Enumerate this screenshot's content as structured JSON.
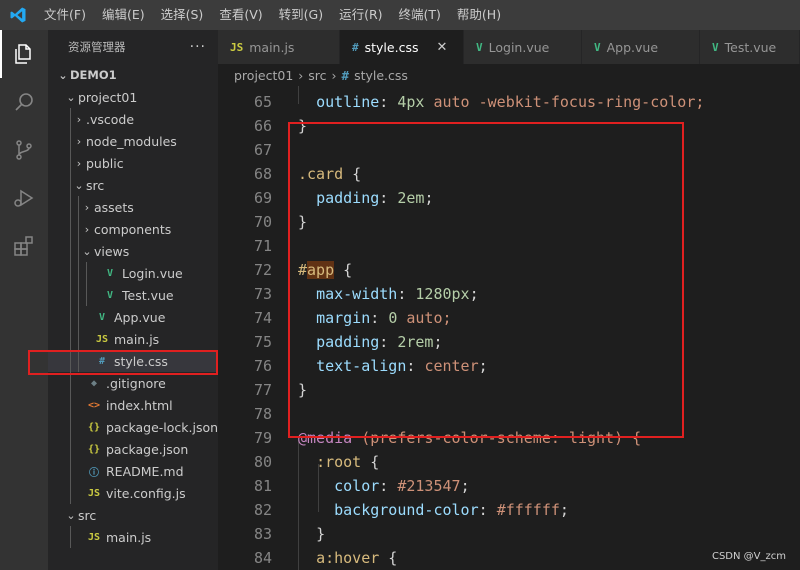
{
  "menu": {
    "items": [
      "文件(F)",
      "编辑(E)",
      "选择(S)",
      "查看(V)",
      "转到(G)",
      "运行(R)",
      "终端(T)",
      "帮助(H)"
    ]
  },
  "colors": {
    "accent_blue": "#007acc",
    "vue_green": "#41b883",
    "js_yellow": "#cbcb41",
    "css_blue": "#519aba",
    "annotation_red": "#e02020"
  },
  "sidebar": {
    "title": "资源管理器",
    "more": "···",
    "tree": [
      {
        "label": "DEMO1",
        "chevron": "⌄",
        "icon": "",
        "level": 0,
        "bold": true
      },
      {
        "label": "project01",
        "chevron": "⌄",
        "icon": "",
        "level": 1
      },
      {
        "label": ".vscode",
        "chevron": "›",
        "icon": "",
        "level": 2
      },
      {
        "label": "node_modules",
        "chevron": "›",
        "icon": "",
        "level": 2
      },
      {
        "label": "public",
        "chevron": "›",
        "icon": "",
        "level": 2
      },
      {
        "label": "src",
        "chevron": "⌄",
        "icon": "",
        "level": 2
      },
      {
        "label": "assets",
        "chevron": "›",
        "icon": "",
        "level": 3
      },
      {
        "label": "components",
        "chevron": "›",
        "icon": "",
        "level": 3
      },
      {
        "label": "views",
        "chevron": "⌄",
        "icon": "",
        "level": 3
      },
      {
        "label": "Login.vue",
        "chevron": "",
        "icon": "V",
        "iconColor": "#41b883",
        "level": 4
      },
      {
        "label": "Test.vue",
        "chevron": "",
        "icon": "V",
        "iconColor": "#41b883",
        "level": 4
      },
      {
        "label": "App.vue",
        "chevron": "",
        "icon": "V",
        "iconColor": "#41b883",
        "level": 3
      },
      {
        "label": "main.js",
        "chevron": "",
        "icon": "JS",
        "iconColor": "#cbcb41",
        "level": 3
      },
      {
        "label": "style.css",
        "chevron": "",
        "icon": "#",
        "iconColor": "#519aba",
        "level": 3,
        "selected": true
      },
      {
        "label": ".gitignore",
        "chevron": "",
        "icon": "◆",
        "iconColor": "#6d8086",
        "level": 2
      },
      {
        "label": "index.html",
        "chevron": "",
        "icon": "<>",
        "iconColor": "#e37933",
        "level": 2
      },
      {
        "label": "package-lock.json",
        "chevron": "",
        "icon": "{}",
        "iconColor": "#cbcb41",
        "level": 2
      },
      {
        "label": "package.json",
        "chevron": "",
        "icon": "{}",
        "iconColor": "#cbcb41",
        "level": 2
      },
      {
        "label": "README.md",
        "chevron": "",
        "icon": "ⓘ",
        "iconColor": "#519aba",
        "level": 2
      },
      {
        "label": "vite.config.js",
        "chevron": "",
        "icon": "JS",
        "iconColor": "#cbcb41",
        "level": 2
      },
      {
        "label": "src",
        "chevron": "⌄",
        "icon": "",
        "level": 1
      },
      {
        "label": "main.js",
        "chevron": "",
        "icon": "JS",
        "iconColor": "#cbcb41",
        "level": 2
      }
    ]
  },
  "tabs": [
    {
      "label": "main.js",
      "icon": "JS",
      "iconColor": "#cbcb41",
      "active": false
    },
    {
      "label": "style.css",
      "icon": "#",
      "iconColor": "#519aba",
      "active": true,
      "close": "✕"
    },
    {
      "label": "Login.vue",
      "icon": "V",
      "iconColor": "#41b883",
      "active": false
    },
    {
      "label": "App.vue",
      "icon": "V",
      "iconColor": "#41b883",
      "active": false
    },
    {
      "label": "Test.vue",
      "icon": "V",
      "iconColor": "#41b883",
      "active": false
    }
  ],
  "breadcrumb": {
    "parts": [
      "project01",
      "src"
    ],
    "file_icon": "#",
    "file": "style.css"
  },
  "editor": {
    "lines": [
      {
        "n": "65",
        "tokens": [
          [
            "  ",
            ""
          ],
          [
            "outline",
            "c-prop"
          ],
          [
            ": ",
            ""
          ],
          [
            "4px",
            "c-num"
          ],
          [
            " auto -webkit-focus-ring-color;",
            "c-val"
          ]
        ]
      },
      {
        "n": "66",
        "tokens": [
          [
            "}",
            "c-brace"
          ]
        ]
      },
      {
        "n": "67",
        "tokens": []
      },
      {
        "n": "68",
        "tokens": [
          [
            ".card",
            "c-sel"
          ],
          [
            " {",
            "c-brace"
          ]
        ]
      },
      {
        "n": "69",
        "tokens": [
          [
            "  ",
            ""
          ],
          [
            "padding",
            "c-prop"
          ],
          [
            ": ",
            ""
          ],
          [
            "2em",
            "c-num"
          ],
          [
            ";",
            ""
          ]
        ]
      },
      {
        "n": "70",
        "tokens": [
          [
            "}",
            "c-brace"
          ]
        ]
      },
      {
        "n": "71",
        "tokens": []
      },
      {
        "n": "72",
        "tokens": [
          [
            "#",
            "c-sel"
          ],
          [
            "app",
            "c-sel hl-word"
          ],
          [
            " {",
            "c-brace"
          ]
        ]
      },
      {
        "n": "73",
        "tokens": [
          [
            "  ",
            ""
          ],
          [
            "max-width",
            "c-prop"
          ],
          [
            ": ",
            ""
          ],
          [
            "1280px",
            "c-num"
          ],
          [
            ";",
            ""
          ]
        ]
      },
      {
        "n": "74",
        "tokens": [
          [
            "  ",
            ""
          ],
          [
            "margin",
            "c-prop"
          ],
          [
            ": ",
            ""
          ],
          [
            "0",
            "c-num"
          ],
          [
            " auto;",
            "c-val"
          ]
        ]
      },
      {
        "n": "75",
        "tokens": [
          [
            "  ",
            ""
          ],
          [
            "padding",
            "c-prop"
          ],
          [
            ": ",
            ""
          ],
          [
            "2rem",
            "c-num"
          ],
          [
            ";",
            ""
          ]
        ]
      },
      {
        "n": "76",
        "tokens": [
          [
            "  ",
            ""
          ],
          [
            "text-align",
            "c-prop"
          ],
          [
            ": ",
            ""
          ],
          [
            "center",
            "c-val"
          ],
          [
            ";",
            ""
          ]
        ]
      },
      {
        "n": "77",
        "tokens": [
          [
            "}",
            "c-brace"
          ]
        ]
      },
      {
        "n": "78",
        "tokens": []
      },
      {
        "n": "79",
        "tokens": [
          [
            "@media",
            "c-kw"
          ],
          [
            " (prefers-color-scheme: light) {",
            "c-val"
          ]
        ]
      },
      {
        "n": "80",
        "tokens": [
          [
            "  ",
            ""
          ],
          [
            ":root",
            "c-sel"
          ],
          [
            " {",
            "c-brace"
          ]
        ]
      },
      {
        "n": "81",
        "tokens": [
          [
            "    ",
            ""
          ],
          [
            "color",
            "c-prop"
          ],
          [
            ": ",
            ""
          ],
          [
            "#213547",
            "c-val"
          ],
          [
            ";",
            ""
          ]
        ]
      },
      {
        "n": "82",
        "tokens": [
          [
            "    ",
            ""
          ],
          [
            "background-color",
            "c-prop"
          ],
          [
            ": ",
            ""
          ],
          [
            "#ffffff",
            "c-val"
          ],
          [
            ";",
            ""
          ]
        ]
      },
      {
        "n": "83",
        "tokens": [
          [
            "  ",
            ""
          ],
          [
            "}",
            "c-brace"
          ]
        ]
      },
      {
        "n": "84",
        "tokens": [
          [
            "  ",
            ""
          ],
          [
            "a:hover",
            "c-sel"
          ],
          [
            " {",
            "c-brace"
          ]
        ]
      }
    ]
  },
  "watermark": "CSDN @V_zcm"
}
